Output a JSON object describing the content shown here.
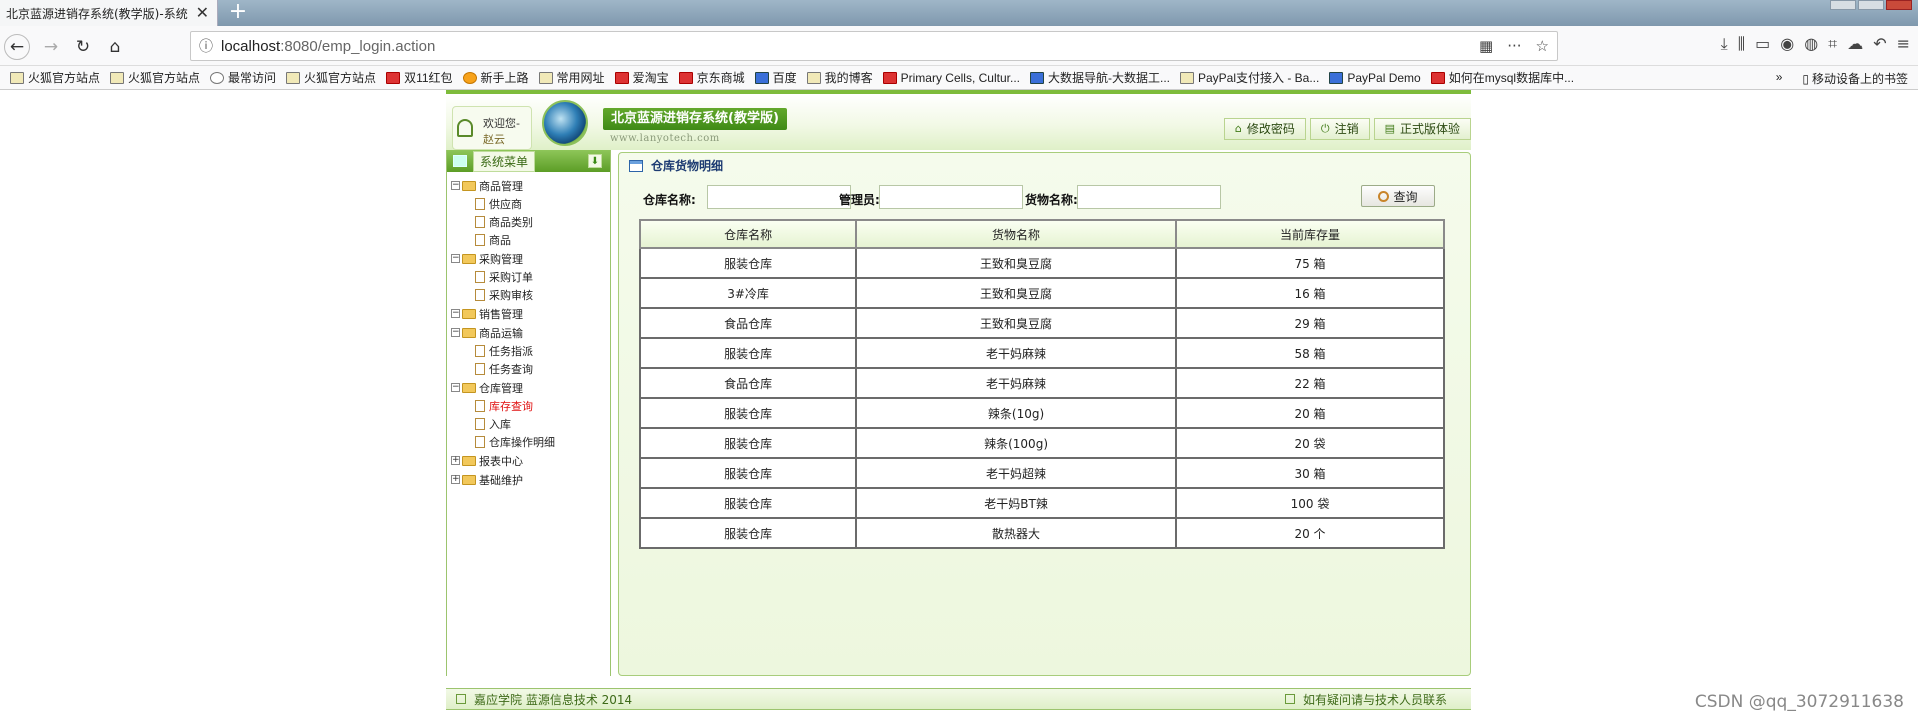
{
  "browser": {
    "tab_title": "北京蓝源进销存系统(教学版)-系统",
    "url_host": "localhost",
    "url_rest": ":8080/emp_login.action",
    "bookmarks": [
      {
        "label": "火狐官方站点",
        "icon": "folder"
      },
      {
        "label": "火狐官方站点",
        "icon": "folder"
      },
      {
        "label": "最常访问",
        "icon": "gear"
      },
      {
        "label": "火狐官方站点",
        "icon": "folder"
      },
      {
        "label": "双11红包",
        "icon": "red"
      },
      {
        "label": "新手上路",
        "icon": "orange"
      },
      {
        "label": "常用网址",
        "icon": "folder"
      },
      {
        "label": "爱淘宝",
        "icon": "red"
      },
      {
        "label": "京东商城",
        "icon": "red"
      },
      {
        "label": "百度",
        "icon": "blue"
      },
      {
        "label": "我的博客",
        "icon": "folder"
      },
      {
        "label": "Primary Cells, Cultur...",
        "icon": "red"
      },
      {
        "label": "大数据导航-大数据工...",
        "icon": "blue"
      },
      {
        "label": "PayPal支付接入 - Ba...",
        "icon": "folder"
      },
      {
        "label": "PayPal Demo",
        "icon": "blue"
      },
      {
        "label": "如何在mysql数据库中...",
        "icon": "red"
      }
    ],
    "bookmarks_overflow": "»",
    "mobile_bookmarks": "移动设备上的书签"
  },
  "header": {
    "welcome_line1": "欢迎您-",
    "welcome_line2": "赵云",
    "system_title": "北京蓝源进销存系统(教学版)",
    "site_url": "www.lanyotech.com",
    "buttons": [
      {
        "label": "修改密码",
        "icon": "⌂"
      },
      {
        "label": "注销",
        "icon": "⏻"
      },
      {
        "label": "正式版体验",
        "icon": "▤"
      }
    ]
  },
  "sidebar": {
    "title": "系统菜单",
    "tree": [
      {
        "label": "商品管理",
        "expanded": true,
        "children": [
          {
            "label": "供应商"
          },
          {
            "label": "商品类别"
          },
          {
            "label": "商品"
          }
        ]
      },
      {
        "label": "采购管理",
        "expanded": true,
        "children": [
          {
            "label": "采购订单"
          },
          {
            "label": "采购审核"
          }
        ]
      },
      {
        "label": "销售管理",
        "expanded": true,
        "children": []
      },
      {
        "label": "商品运输",
        "expanded": true,
        "children": [
          {
            "label": "任务指派"
          },
          {
            "label": "任务查询"
          }
        ]
      },
      {
        "label": "仓库管理",
        "expanded": true,
        "children": [
          {
            "label": "库存查询",
            "active": true
          },
          {
            "label": "入库"
          },
          {
            "label": "仓库操作明细"
          }
        ]
      },
      {
        "label": "报表中心",
        "expanded": false,
        "children": []
      },
      {
        "label": "基础维护",
        "expanded": false,
        "children": []
      }
    ]
  },
  "main": {
    "title": "仓库货物明细",
    "search": {
      "warehouse_label": "仓库名称:",
      "manager_label": "管理员:",
      "goods_label": "货物名称:",
      "warehouse_value": "",
      "manager_value": "",
      "goods_value": "",
      "query_button": "查询"
    },
    "table": {
      "headers": [
        "仓库名称",
        "货物名称",
        "当前库存量"
      ],
      "rows": [
        [
          "服装仓库",
          "王致和臭豆腐",
          "75 箱"
        ],
        [
          "3#冷库",
          "王致和臭豆腐",
          "16 箱"
        ],
        [
          "食品仓库",
          "王致和臭豆腐",
          "29 箱"
        ],
        [
          "服装仓库",
          "老干妈麻辣",
          "58 箱"
        ],
        [
          "食品仓库",
          "老干妈麻辣",
          "22 箱"
        ],
        [
          "服装仓库",
          "辣条(10g)",
          "20 箱"
        ],
        [
          "服装仓库",
          "辣条(100g)",
          "20 袋"
        ],
        [
          "服装仓库",
          "老干妈超辣",
          "30 箱"
        ],
        [
          "服装仓库",
          "老干妈BT辣",
          "100 袋"
        ],
        [
          "服装仓库",
          "散热器大",
          "20 个"
        ]
      ]
    }
  },
  "footer": {
    "left": "嘉应学院 蓝源信息技术 2014",
    "right": "如有疑问请与技术人员联系"
  },
  "watermark": "CSDN @qq_3072911638"
}
